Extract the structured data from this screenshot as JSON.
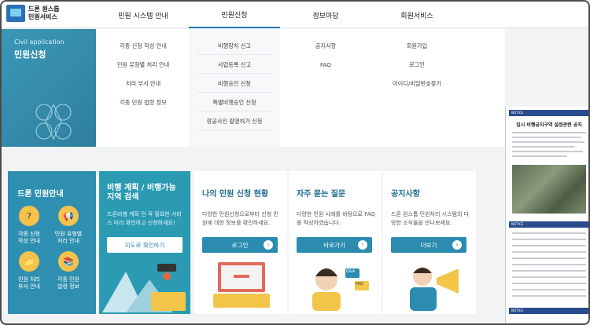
{
  "header": {
    "logo_line1": "드론 원스톱",
    "logo_line2": "민원서비스",
    "nav": [
      "민원 시스템 안내",
      "민원신청",
      "정보마당",
      "회원서비스"
    ]
  },
  "dropdown": {
    "side_en": "Civil application",
    "side_ko": "민원신청",
    "col1": [
      "각종 신청 작성 안내",
      "민원 유형별 처리 안내",
      "처리 부서 안내",
      "각종 민원 법령 정보"
    ],
    "col2": [
      "비행장치 신고",
      "사업등록 신고",
      "비행승인 신청",
      "특별비행승인 신청",
      "항공사진 촬영허가 신청"
    ],
    "col3": [
      "공지사항",
      "FAQ"
    ],
    "col4": [
      "회원가입",
      "로그인",
      "아이디/비밀번호찾기"
    ]
  },
  "guide": {
    "title": "드론 민원안내",
    "items": [
      {
        "l1": "각종 신청",
        "l2": "작성 안내",
        "icon": "?"
      },
      {
        "l1": "민원 유형별",
        "l2": "처리 안내",
        "icon": "📢"
      },
      {
        "l1": "민원 처리",
        "l2": "부서 안내",
        "icon": "📁"
      },
      {
        "l1": "각종 민원",
        "l2": "법령 정보",
        "icon": "📚"
      }
    ]
  },
  "flight": {
    "title_l1": "비행 계획 / 비행가능",
    "title_l2": "지역 검색",
    "desc": "드론비행 계획 전 꼭 필요한 서비스 미리 확인하고 신청하세요!",
    "button": "지도로 확인하기"
  },
  "cards": [
    {
      "title": "나의 민원 신청 현황",
      "desc": "다양한 민원신청으로부터 신청 민원에 대한 정보를 확인하세요.",
      "button": "로그인"
    },
    {
      "title": "자주 묻는 질문",
      "desc": "다양한 민원 사례를 바탕으로 FAQ를 작성하였습니다.",
      "button": "바로가기"
    },
    {
      "title": "공지사항",
      "desc": "드론 원스톱 민원처리 시스템의 다양한 소식들을 만나보세요.",
      "button": "더보기"
    }
  ],
  "faq_bubbles": [
    "Q&A",
    "FAQ"
  ],
  "notice": {
    "label": "NOTICE",
    "title": "임시 비행금지구역 설정관련 공지"
  },
  "colors": {
    "teal": "#2f8fb0",
    "accent": "#2b8cb0",
    "navy": "#2a4c8c"
  }
}
